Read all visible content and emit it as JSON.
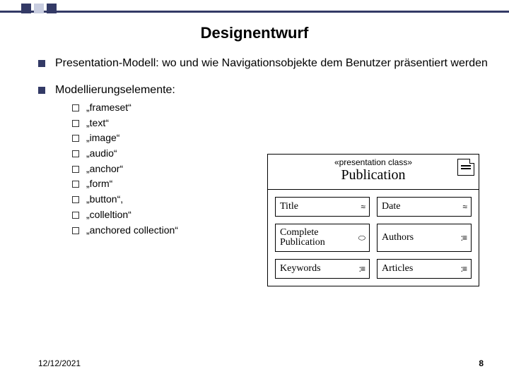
{
  "title": "Designentwurf",
  "bullets": [
    {
      "text": "Presentation-Modell: wo und wie Navigationsobjekte dem Benutzer präsentiert werden"
    },
    {
      "text": "Modellierungselemente:",
      "sub": [
        "„frameset“",
        "„text“",
        "„image“",
        "„audio“",
        "„anchor“",
        "„form“",
        "„button“,",
        "„colleltion“",
        "„anchored collection“"
      ]
    }
  ],
  "diagram": {
    "stereotype": "«presentation class»",
    "title": "Publication",
    "cells": [
      [
        {
          "label": "Title",
          "mark": "≈"
        },
        {
          "label": "Date",
          "mark": "≈"
        }
      ],
      [
        {
          "label": "Complete Publication",
          "mark": "⬭"
        },
        {
          "label": "Authors",
          "mark": ":≡"
        }
      ],
      [
        {
          "label": "Keywords",
          "mark": ":≡"
        },
        {
          "label": "Articles",
          "mark": ":≡"
        }
      ]
    ]
  },
  "footer": {
    "date": "12/12/2021",
    "page": "8"
  }
}
